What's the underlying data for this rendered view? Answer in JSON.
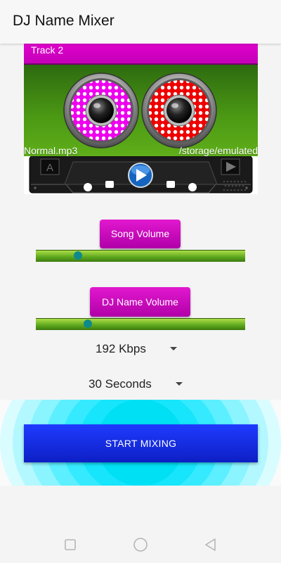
{
  "app": {
    "title": "DJ Name Mixer"
  },
  "track": {
    "label": "Track 2",
    "file_name": "Normal.mp3",
    "file_path": "/storage/emulated",
    "cassette_side": "A"
  },
  "sliders": {
    "song_volume": {
      "label": "Song Volume",
      "value_percent": 20
    },
    "dj_volume": {
      "label": "DJ Name Volume",
      "value_percent": 25
    }
  },
  "spinners": {
    "bitrate": {
      "value": "192 Kbps"
    },
    "duration": {
      "value": "30 Seconds"
    }
  },
  "start_button": {
    "label": "START MIXING"
  },
  "colors": {
    "magenta": "#d000c0",
    "green": "#5aa51c",
    "blue_button": "#1428e0",
    "cyan": "#00e5ff",
    "thumb": "#0f8a8a"
  },
  "icons": [
    "play-icon",
    "next-icon",
    "recent-apps-icon",
    "home-icon",
    "back-icon"
  ]
}
